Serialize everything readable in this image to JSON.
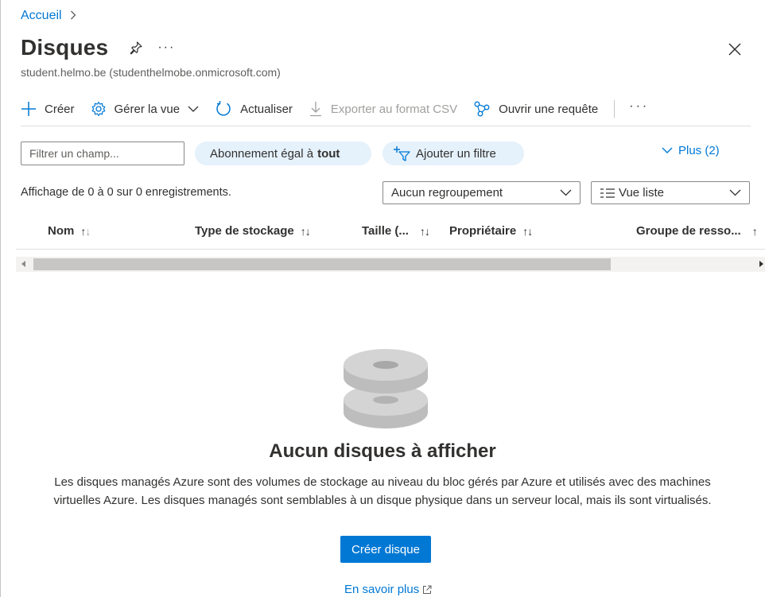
{
  "breadcrumb": {
    "home": "Accueil"
  },
  "header": {
    "title": "Disques",
    "subtitle": "student.helmo.be (studenthelmobe.onmicrosoft.com)",
    "more": "···"
  },
  "toolbar": {
    "create": "Créer",
    "manage_view": "Gérer la vue",
    "refresh": "Actualiser",
    "export_csv": "Exporter au format CSV",
    "open_query": "Ouvrir une requête",
    "more": "···"
  },
  "filters": {
    "placeholder": "Filtrer un champ...",
    "subscription_prefix": "Abonnement égal à",
    "subscription_value": "tout",
    "add_filter": "Ajouter un filtre",
    "more_filters": "Plus (2)"
  },
  "list": {
    "record_count": "Affichage de 0 à 0 sur 0 enregistrements.",
    "grouping": "Aucun regroupement",
    "view_mode": "Vue liste",
    "columns": [
      "Nom",
      "Type de stockage",
      "Taille (...",
      "Propriétaire",
      "Groupe de resso..."
    ]
  },
  "empty_state": {
    "title": "Aucun disques à afficher",
    "description": "Les disques managés Azure sont des volumes de stockage au niveau du bloc gérés par Azure et utilisés avec des machines virtuelles Azure. Les disques managés sont semblables à un disque physique dans un serveur local, mais ils sont virtualisés.",
    "create_button": "Créer disque",
    "learn_more": "En savoir plus"
  },
  "colors": {
    "accent": "#0078d4",
    "pill_bg": "#e5f1fb",
    "text": "#323130",
    "disabled": "#a19f9d"
  }
}
